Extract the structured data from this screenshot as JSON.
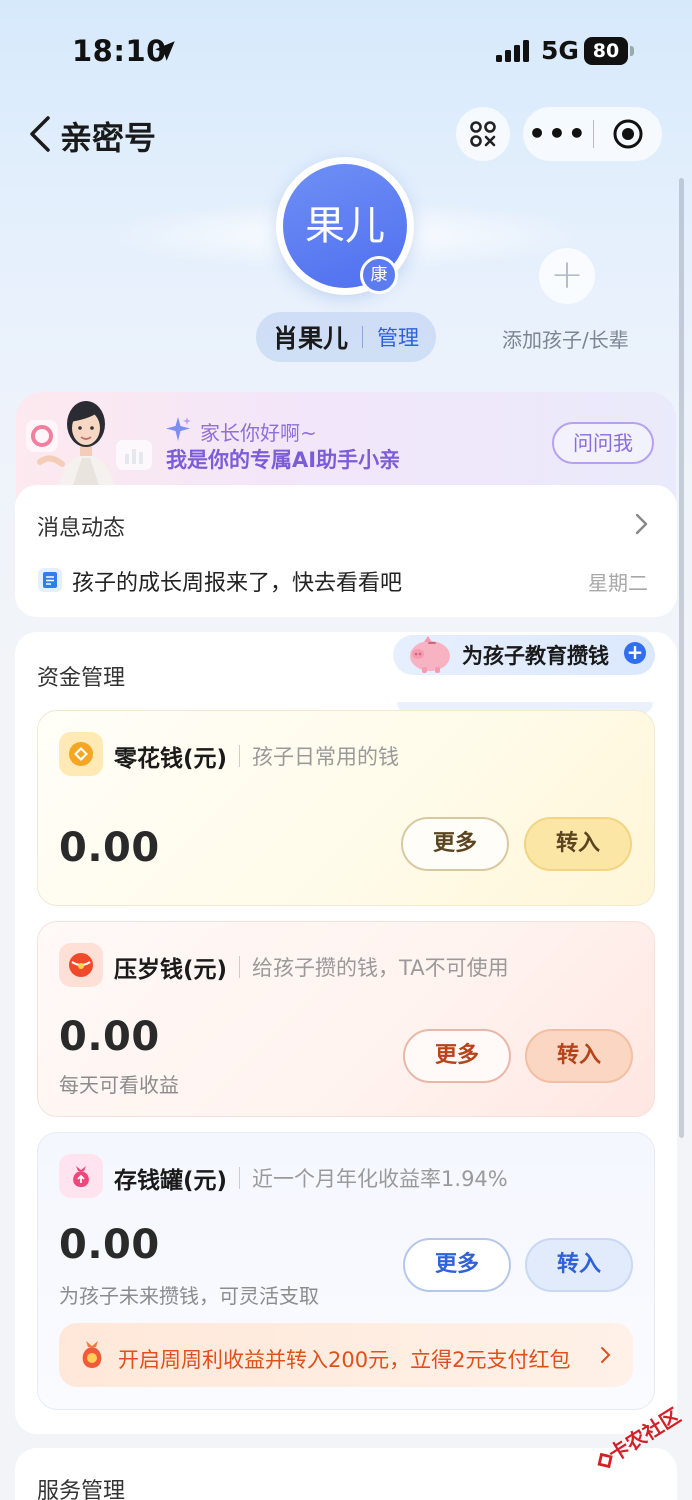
{
  "status_bar": {
    "time": "18:10",
    "network": "5G",
    "battery": "80"
  },
  "nav": {
    "title": "亲密号"
  },
  "profile": {
    "avatar_text": "果儿",
    "badge": "康",
    "name": "肖果儿",
    "manage": "管理"
  },
  "add": {
    "label": "添加孩子/长辈"
  },
  "ai_banner": {
    "greeting": "家长你好啊~",
    "intro": "我是你的专属AI助手小亲",
    "ask": "问问我"
  },
  "messages": {
    "title": "消息动态",
    "item_text": "孩子的成长周报来了，快去看看吧",
    "item_time": "星期二"
  },
  "funds": {
    "title": "资金管理",
    "edu": "为孩子教育攒钱",
    "accounts": [
      {
        "name": "零花钱(元)",
        "desc": "孩子日常用的钱",
        "amount": "0.00",
        "note": "",
        "more": "更多",
        "in": "转入"
      },
      {
        "name": "压岁钱(元)",
        "desc": "给孩子攒的钱，TA不可使用",
        "amount": "0.00",
        "note": "每天可看收益",
        "more": "更多",
        "in": "转入"
      },
      {
        "name": "存钱罐(元)",
        "desc": "近一个月年化收益率1.94%",
        "amount": "0.00",
        "note": "为孩子未来攒钱，可灵活支取",
        "more": "更多",
        "in": "转入"
      }
    ],
    "promo": "开启周周利收益并转入200元，立得2元支付红包"
  },
  "services": {
    "title": "服务管理"
  },
  "watermark": "卡农社区",
  "colors": {
    "accent": "#2f6ff0",
    "avatar": "#5b7cf0",
    "promo": "#e0501a"
  }
}
